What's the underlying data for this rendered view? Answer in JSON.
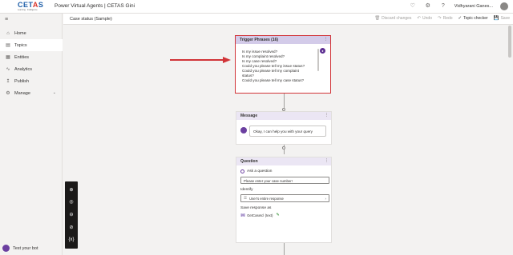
{
  "header": {
    "logo_brand_pre": "CET",
    "logo_brand_hl": "A",
    "logo_brand_post": "S",
    "logo_tagline": "Learning · Intelligence",
    "app_title": "Power Virtual Agents | CETAS Gini",
    "user_name": "Vidhyarani Ganes...",
    "icons": [
      "bell-icon",
      "gear-icon",
      "help-icon",
      "avatar"
    ]
  },
  "sidebar": {
    "items": [
      {
        "label": "Home",
        "icon": "home-icon"
      },
      {
        "label": "Topics",
        "icon": "topics-icon",
        "active": true
      },
      {
        "label": "Entities",
        "icon": "entities-icon"
      },
      {
        "label": "Analytics",
        "icon": "analytics-icon"
      },
      {
        "label": "Publish",
        "icon": "publish-icon"
      },
      {
        "label": "Manage",
        "icon": "manage-icon",
        "expandable": true
      }
    ],
    "test_bot_label": "Test your bot"
  },
  "subbar": {
    "breadcrumb": "Case status (Sample)",
    "toolbar": {
      "discard": "Discard changes",
      "undo": "Undo",
      "redo": "Redo",
      "topic_checker": "Topic checker",
      "save": "Save"
    }
  },
  "canvas": {
    "trigger": {
      "title": "Trigger Phrases (16)",
      "phrases": [
        "Is my issue resolved?",
        "Is my complaint resolved?",
        "Is my case resolved?",
        "Could you please tell my issue status?",
        "Could you please tell my complaint",
        "status?",
        "Could you please tell my case status?"
      ]
    },
    "message": {
      "title": "Message",
      "text": "Okay, I can help you with your query"
    },
    "question": {
      "title": "Question",
      "ask_label": "Ask a question",
      "prompt_value": "Please enter your case number!",
      "identify_label": "Identify",
      "identify_value": "User's entire response",
      "save_label": "Save response as",
      "variable_badge": "{x}",
      "variable_name": "GetCaseId",
      "variable_type": "(text)"
    }
  },
  "zoom": [
    "zoom-in-icon",
    "fit-icon",
    "zoom-out-icon",
    "reset-icon",
    "variables-icon"
  ],
  "colors": {
    "accent_purple": "#6b3fa0",
    "trigger_header": "#d3cbe9",
    "highlight_red": "#d13438"
  }
}
